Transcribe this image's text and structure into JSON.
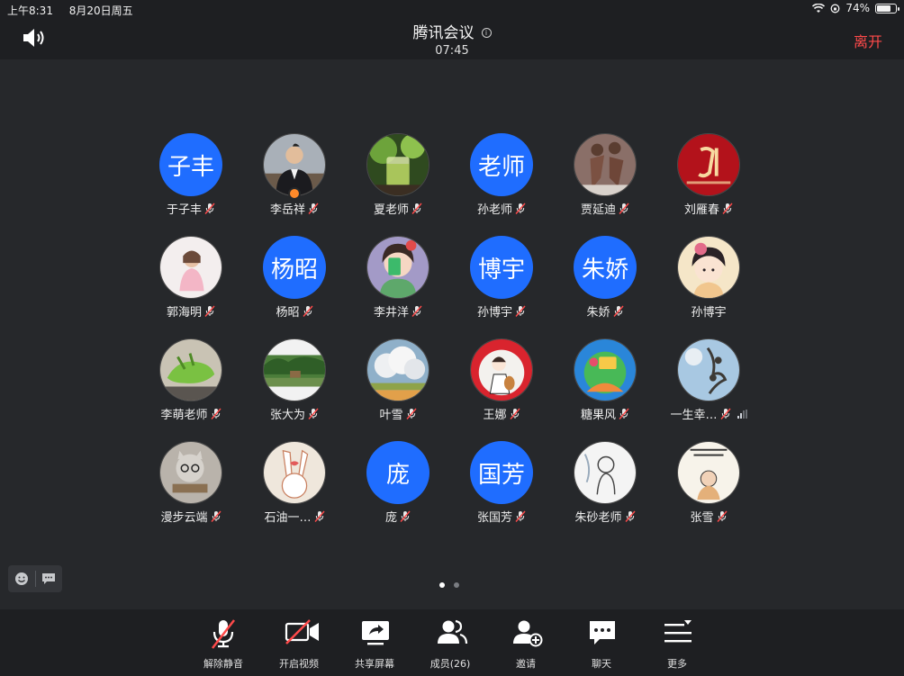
{
  "status_bar": {
    "time": "上午8:31",
    "date": "8月20日周五",
    "battery": "74%",
    "battery_level": 0.74
  },
  "header": {
    "title": "腾讯会议",
    "timer": "07:45",
    "leave": "离开",
    "accent": "#ff4a4a"
  },
  "participants": [
    {
      "name": "于子丰",
      "avatar_text": "子丰",
      "muted": true
    },
    {
      "name": "李岳祥",
      "avatar": "photo-man-suit",
      "muted": true,
      "host": true
    },
    {
      "name": "夏老师",
      "avatar": "photo-tea-cup",
      "muted": true
    },
    {
      "name": "孙老师",
      "avatar_text": "老师",
      "muted": true
    },
    {
      "name": "贾延迪",
      "avatar": "photo-dancers",
      "muted": true
    },
    {
      "name": "刘雁春",
      "avatar": "photo-red-calligraphy",
      "muted": true
    },
    {
      "name": "郭海明",
      "avatar": "photo-little-girl",
      "muted": true
    },
    {
      "name": "杨昭",
      "avatar_text": "杨昭",
      "muted": true
    },
    {
      "name": "李井洋",
      "avatar": "cartoon-girl-phone",
      "muted": true
    },
    {
      "name": "孙博宇",
      "avatar_text": "博宇",
      "muted": true
    },
    {
      "name": "朱娇",
      "avatar_text": "朱娇",
      "muted": true
    },
    {
      "name": "孙博宇",
      "avatar": "cartoon-hanfu-girl",
      "muted": false
    },
    {
      "name": "李萌老师",
      "avatar": "photo-toy-dinosaur",
      "muted": true
    },
    {
      "name": "张大为",
      "avatar": "photo-landscape",
      "muted": true
    },
    {
      "name": "叶雪",
      "avatar": "photo-clouds",
      "muted": true
    },
    {
      "name": "王娜",
      "avatar": "cartoon-girl-guitar",
      "muted": true
    },
    {
      "name": "糖果风",
      "avatar": "illustration-colorful",
      "muted": true
    },
    {
      "name": "一生幸…",
      "avatar": "photo-sky-tree",
      "muted": true,
      "signal": true
    },
    {
      "name": "漫步云端",
      "avatar": "photo-cat-glasses",
      "muted": true
    },
    {
      "name": "石油一…",
      "avatar": "drawing-bunny",
      "muted": true
    },
    {
      "name": "庞",
      "avatar_text": "庞",
      "muted": true
    },
    {
      "name": "张国芳",
      "avatar_text": "国芳",
      "muted": true
    },
    {
      "name": "朱砂老师",
      "avatar": "sketch-child",
      "muted": true
    },
    {
      "name": "张雪",
      "avatar": "drawing-girl-text",
      "muted": true
    }
  ],
  "pagination": {
    "pages": 2,
    "current": 1
  },
  "toolbar": [
    {
      "label": "解除静音",
      "icon": "mic-off-icon"
    },
    {
      "label": "开启视频",
      "icon": "video-off-icon"
    },
    {
      "label": "共享屏幕",
      "icon": "share-screen-icon"
    },
    {
      "label": "成员(26)",
      "icon": "members-icon"
    },
    {
      "label": "邀请",
      "icon": "invite-icon"
    },
    {
      "label": "聊天",
      "icon": "chat-icon"
    },
    {
      "label": "更多",
      "icon": "more-icon"
    }
  ],
  "colors": {
    "background": "#26282b",
    "bar": "#1e1f22",
    "avatar_blue": "#1f6dff",
    "muted_red": "#ff4a4a"
  }
}
